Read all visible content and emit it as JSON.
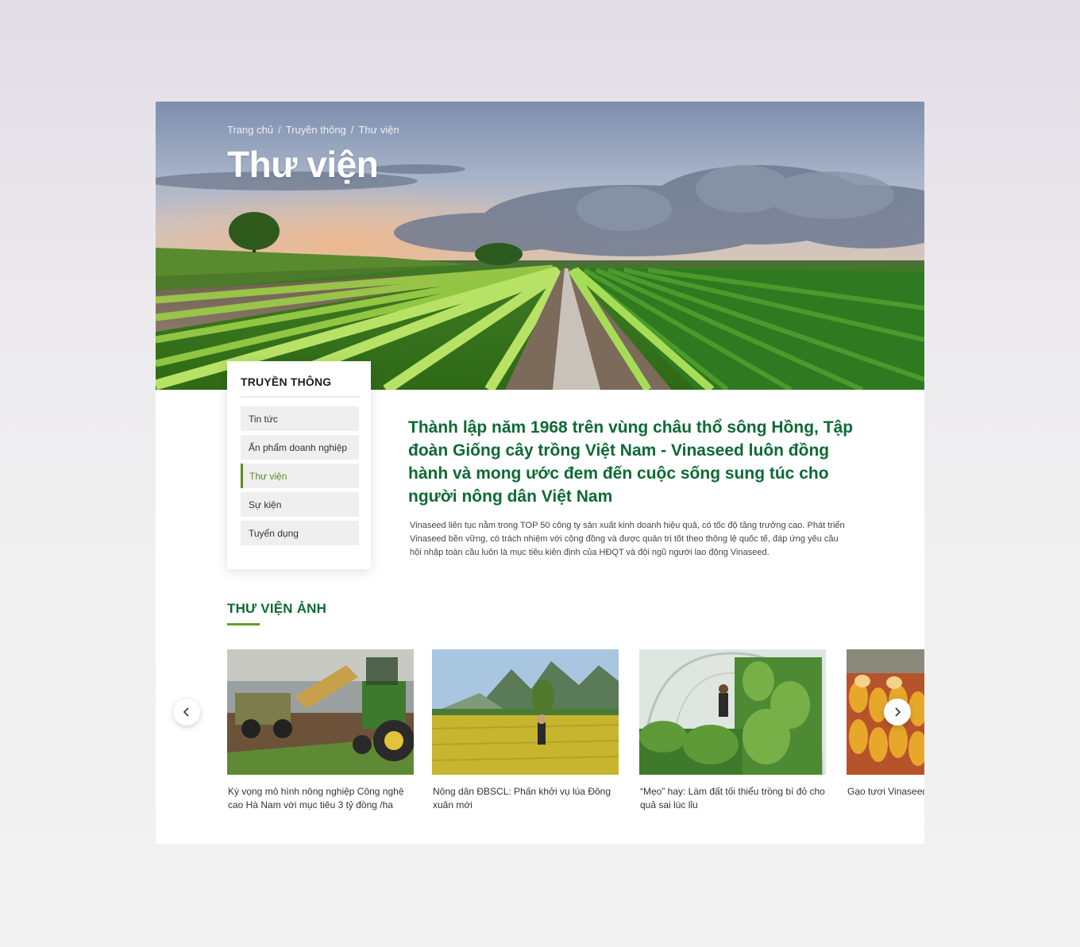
{
  "breadcrumb": {
    "home": "Trang chủ",
    "sep1": "/",
    "section": "Truyền thông",
    "sep2": "/",
    "current": "Thư viện"
  },
  "hero": {
    "title": "Thư viện"
  },
  "sidebar": {
    "title": "TRUYỀN THÔNG",
    "items": [
      {
        "label": "Tin tức"
      },
      {
        "label": "Ấn phẩm doanh nghiệp"
      },
      {
        "label": "Thư viện"
      },
      {
        "label": "Sự kiện"
      },
      {
        "label": "Tuyển dụng"
      }
    ],
    "active_index": 2
  },
  "intro": {
    "heading": "Thành lập năm 1968 trên vùng châu thổ sông Hồng, Tập đoàn Giống cây trồng Việt Nam - Vinaseed luôn đồng hành và mong ước đem đến cuộc sống sung túc cho người nông dân Việt Nam",
    "body": "Vinaseed liên tục nằm trong TOP 50 công ty sản xuất kinh doanh hiệu quả, có tốc độ tăng trưởng cao. Phát triển Vinaseed bền vững, có trách nhiệm với cộng đồng và được quản trị tốt theo thông lệ quốc tế, đáp ứng yêu cầu hội nhập toàn cầu luôn là mục tiêu kiên định của HĐQT và đội ngũ người lao động Vinaseed."
  },
  "gallery": {
    "title": "THƯ VIỆN ẢNH",
    "items": [
      {
        "caption": "Kỳ vọng mô hình nông nghiệp Công nghệ cao Hà Nam với mục tiêu 3 tỷ đồng /ha"
      },
      {
        "caption": "Nông dân ĐBSCL: Phấn khởi vụ lúa Đông xuân mới"
      },
      {
        "caption": "“Mẹo” hay: Làm đất tối thiểu trồng bí đỏ cho quả sai lúc lỉu"
      },
      {
        "caption": "Gạo tươi Vinaseed"
      }
    ]
  },
  "colors": {
    "brand_green": "#0d6a34",
    "accent_green": "#5b8a1e",
    "menu_bg": "#efefef"
  },
  "icons": {
    "prev": "chevron-left-icon",
    "next": "chevron-right-icon"
  }
}
